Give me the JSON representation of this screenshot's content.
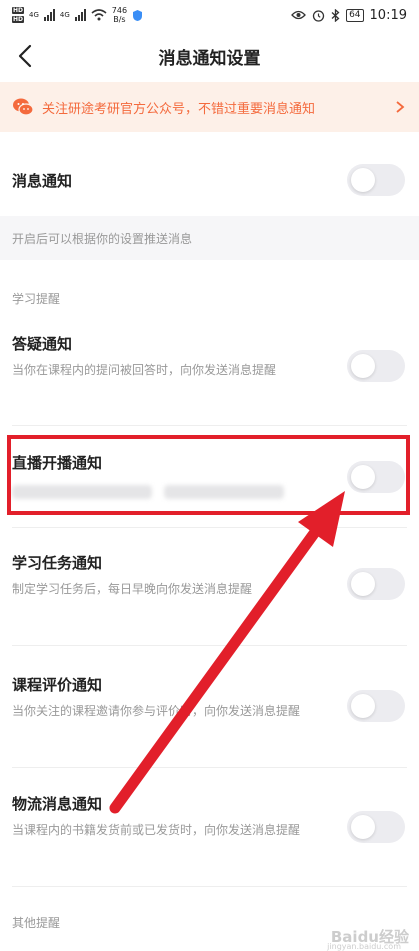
{
  "status_bar": {
    "hd1": "HD",
    "hd2": "HD",
    "net1": "4G",
    "net2": "4G",
    "speed_value": "746",
    "speed_unit": "B/s",
    "battery": "64",
    "time": "10:19"
  },
  "nav": {
    "title": "消息通知设置"
  },
  "banner": {
    "text": "关注研途考研官方公众号，不错过重要消息通知",
    "accent": "#f46a3d"
  },
  "master": {
    "label": "消息通知",
    "hint": "开启后可以根据你的设置推送消息"
  },
  "section_study": "学习提醒",
  "settings": [
    {
      "title": "答疑通知",
      "desc": "当你在课程内的提问被回答时，向你发送消息提醒"
    },
    {
      "title": "直播开播通知",
      "desc": ""
    },
    {
      "title": "学习任务通知",
      "desc": "制定学习任务后，每日早晚向你发送消息提醒"
    },
    {
      "title": "课程评价通知",
      "desc": "当你关注的课程邀请你参与评价时，向你发送消息提醒"
    },
    {
      "title": "物流消息通知",
      "desc": "当课程内的书籍发货前或已发货时，向你发送消息提醒"
    }
  ],
  "section_other": "其他提醒",
  "annotation_color": "#e21f2a",
  "watermark": {
    "main": "Baidu经验",
    "sub": "jingyan.baidu.com"
  }
}
